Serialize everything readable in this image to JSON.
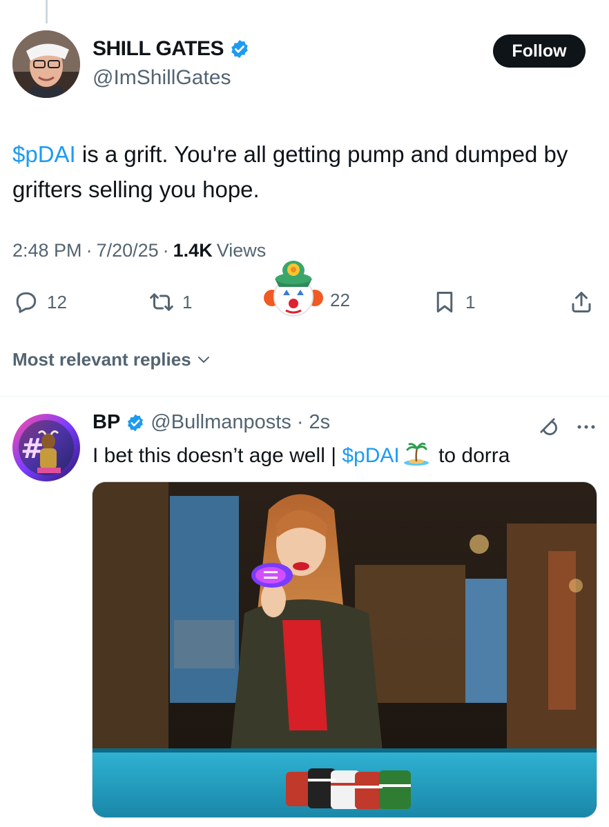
{
  "tweet": {
    "display_name": "SHILL GATES",
    "handle": "@ImShillGates",
    "follow_label": "Follow",
    "text_cashtag": "$pDAI",
    "text_rest": " is a grift. You're all getting pump and dumped by grifters selling you hope.",
    "time": "2:48 PM",
    "date": "7/20/25",
    "views_count": "1.4K",
    "views_label": "Views",
    "sep": "·"
  },
  "actions": {
    "replies": "12",
    "reposts": "1",
    "likes": "22",
    "bookmarks": "1"
  },
  "sort": {
    "label": "Most relevant replies"
  },
  "reply": {
    "display_name": "BP",
    "handle": "@Bullmanposts",
    "sep": "·",
    "time": "2s",
    "text_before": "I bet this doesn’t age well | ",
    "cashtag": "$pDAI",
    "text_after": " to dorra"
  },
  "colors": {
    "accent": "#1d9bf0",
    "text": "#0f1419",
    "muted": "#536471",
    "follow_bg": "#0f1419"
  },
  "icons": [
    "verified-badge-icon",
    "reply-icon",
    "repost-icon",
    "clown-emoji-icon",
    "bookmark-icon",
    "share-icon",
    "chevron-down-icon",
    "grok-icon",
    "more-icon",
    "island-emoji-icon"
  ]
}
